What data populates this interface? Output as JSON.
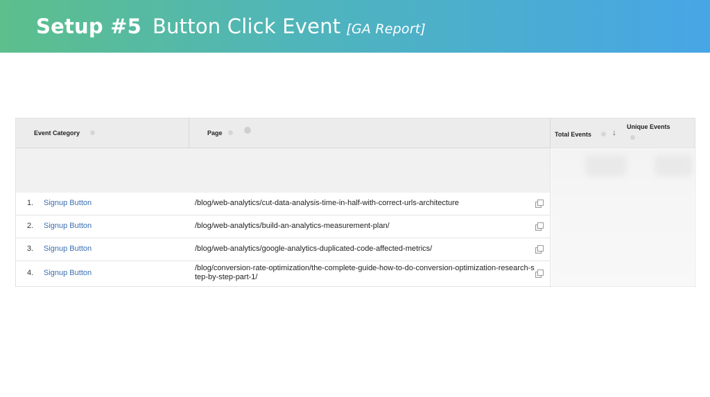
{
  "slide": {
    "title_bold": "Setup #5",
    "title_main": "Button Click Event",
    "title_sub": "[GA Report]",
    "gradient_start": "#5cbf8c",
    "gradient_end": "#47a6e6"
  },
  "report": {
    "columns": {
      "event_category": "Event Category",
      "page": "Page",
      "total_events": "Total Events",
      "unique_events": "Unique Events"
    },
    "sort": {
      "column": "Total Events",
      "direction": "descending"
    },
    "link_color": "#3a6fb0",
    "rows": [
      {
        "index": "1.",
        "category": "Signup Button",
        "page": "/blog/web-analytics/cut-data-analysis-time-in-half-with-correct-urls-architecture"
      },
      {
        "index": "2.",
        "category": "Signup Button",
        "page": "/blog/web-analytics/build-an-analytics-measurement-plan/"
      },
      {
        "index": "3.",
        "category": "Signup Button",
        "page": "/blog/web-analytics/google-analytics-duplicated-code-affected-metrics/"
      },
      {
        "index": "4.",
        "category": "Signup Button",
        "page": "/blog/conversion-rate-optimization/the-complete-guide-how-to-do-conversion-optimization-research-step-by-step-part-1/"
      }
    ]
  }
}
